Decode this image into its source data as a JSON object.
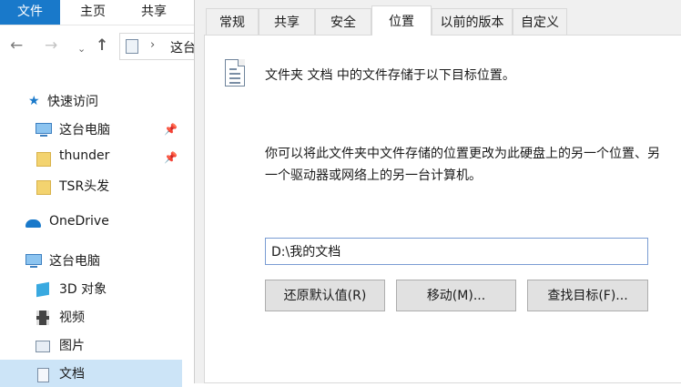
{
  "explorer": {
    "ribbon_tabs": [
      "文件",
      "主页",
      "共享"
    ],
    "address": {
      "crumb": "这台"
    },
    "nav": {
      "quick_access": "快速访问",
      "items": [
        {
          "label": "这台电脑",
          "icon": "computer-icon",
          "pinned": true
        },
        {
          "label": "thunder",
          "icon": "folder-icon",
          "pinned": true
        },
        {
          "label": "TSR头发",
          "icon": "folder-icon",
          "pinned": false
        }
      ],
      "onedrive": "OneDrive",
      "this_pc": "这台电脑",
      "pc_items": [
        {
          "label": "3D 对象",
          "icon": "3d-objects-icon"
        },
        {
          "label": "视频",
          "icon": "video-icon"
        },
        {
          "label": "图片",
          "icon": "pictures-icon"
        },
        {
          "label": "文档",
          "icon": "documents-icon",
          "selected": true
        }
      ]
    }
  },
  "dialog": {
    "tabs": [
      "常规",
      "共享",
      "安全",
      "位置",
      "以前的版本",
      "自定义"
    ],
    "active_tab": "位置",
    "description": "文件夹 文档 中的文件存储于以下目标位置。",
    "help_text": "你可以将此文件夹中文件存储的位置更改为此硬盘上的另一个位置、另一个驱动器或网络上的另一台计算机。",
    "path_value": "D:\\我的文档",
    "buttons": {
      "restore": "还原默认值(R)",
      "move": "移动(M)...",
      "find": "查找目标(F)..."
    }
  },
  "colors": {
    "accent": "#1979ca",
    "selection": "#cce4f7",
    "dialog_bg": "#f0f0f0"
  }
}
